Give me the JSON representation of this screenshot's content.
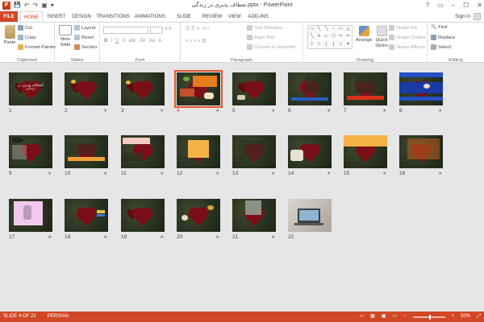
{
  "window": {
    "title": "تعطاف پذیری در زندگی.pptx - PowerPoint",
    "app_icon": "P",
    "controls": [
      "?",
      "▭",
      "–",
      "☐",
      "✕"
    ]
  },
  "qat": {
    "save": "💾",
    "undo": "↶",
    "redo": "↷",
    "present": "▣",
    "customize": "▾"
  },
  "tabs": [
    "FILE",
    "HOME",
    "INSERT",
    "DESIGN",
    "TRANSITIONS",
    "ANIMATIONS",
    "SLIDE SHOW",
    "REVIEW",
    "VIEW",
    "ADD-INS"
  ],
  "active_tab": "HOME",
  "account": {
    "sign_in": "Sign in"
  },
  "ribbon": {
    "clipboard": {
      "paste": "Paste",
      "cut": "Cut",
      "copy": "Copy",
      "format_painter": "Format Painter",
      "label": "Clipboard"
    },
    "slides": {
      "new_slide": "New Slide",
      "layout": "Layout",
      "reset": "Reset",
      "section": "Section",
      "label": "Slides"
    },
    "font": {
      "label": "Font",
      "letters": [
        "B",
        "I",
        "U",
        "S",
        "abc",
        "AV",
        "Aa",
        "A"
      ]
    },
    "paragraph": {
      "text_direction": "Text Direction",
      "align_text": "Align Text",
      "convert_smartart": "Convert to SmartArt",
      "label": "Paragraph"
    },
    "drawing": {
      "arrange": "Arrange",
      "quick_styles": "Quick Styles",
      "shape_fill": "Shape Fill",
      "shape_outline": "Shape Outline",
      "shape_effects": "Shape Effects",
      "label": "Drawing",
      "shapes": [
        "▭",
        "╲",
        "╲",
        "○",
        "▭",
        "△",
        "╲",
        "↳",
        "▭",
        "⬡",
        "⇨",
        "⬄",
        "⇩",
        "☆",
        "{",
        "}",
        "☆",
        "▾"
      ]
    },
    "editing": {
      "find": "Find",
      "replace": "Replace",
      "select": "Select",
      "label": "Editing"
    }
  },
  "slides": [
    {
      "num": "1",
      "star": "",
      "title": "انعطاف پذیری در زندگی"
    },
    {
      "num": "2",
      "star": "★",
      "title": ""
    },
    {
      "num": "3",
      "star": "★",
      "title": ""
    },
    {
      "num": "4",
      "star": "★",
      "title": "",
      "selected": true
    },
    {
      "num": "5",
      "star": "★",
      "title": ""
    },
    {
      "num": "6",
      "star": "★",
      "title": ""
    },
    {
      "num": "7",
      "star": "★",
      "title": ""
    },
    {
      "num": "8",
      "star": "★",
      "title": ""
    },
    {
      "num": "9",
      "star": "★",
      "title": ""
    },
    {
      "num": "10",
      "star": "★",
      "title": ""
    },
    {
      "num": "11",
      "star": "★",
      "title": ""
    },
    {
      "num": "12",
      "star": "★",
      "title": ""
    },
    {
      "num": "13",
      "star": "★",
      "title": ""
    },
    {
      "num": "14",
      "star": "★",
      "title": ""
    },
    {
      "num": "15",
      "star": "★",
      "title": ""
    },
    {
      "num": "16",
      "star": "★",
      "title": ""
    },
    {
      "num": "17",
      "star": "★",
      "title": ""
    },
    {
      "num": "18",
      "star": "★",
      "title": ""
    },
    {
      "num": "19",
      "star": "★",
      "title": ""
    },
    {
      "num": "20",
      "star": "★",
      "title": ""
    },
    {
      "num": "21",
      "star": "★",
      "title": ""
    },
    {
      "num": "22",
      "star": "",
      "title": ""
    }
  ],
  "status": {
    "slide_info": "SLIDE 4 OF 22",
    "language": "PERSIAN",
    "zoom": "50%",
    "zoom_minus": "−",
    "zoom_plus": "+"
  },
  "colors": {
    "accent": "#d24726",
    "selected_outline": "#e2572c",
    "sorter_bg": "#e6e6e6"
  }
}
